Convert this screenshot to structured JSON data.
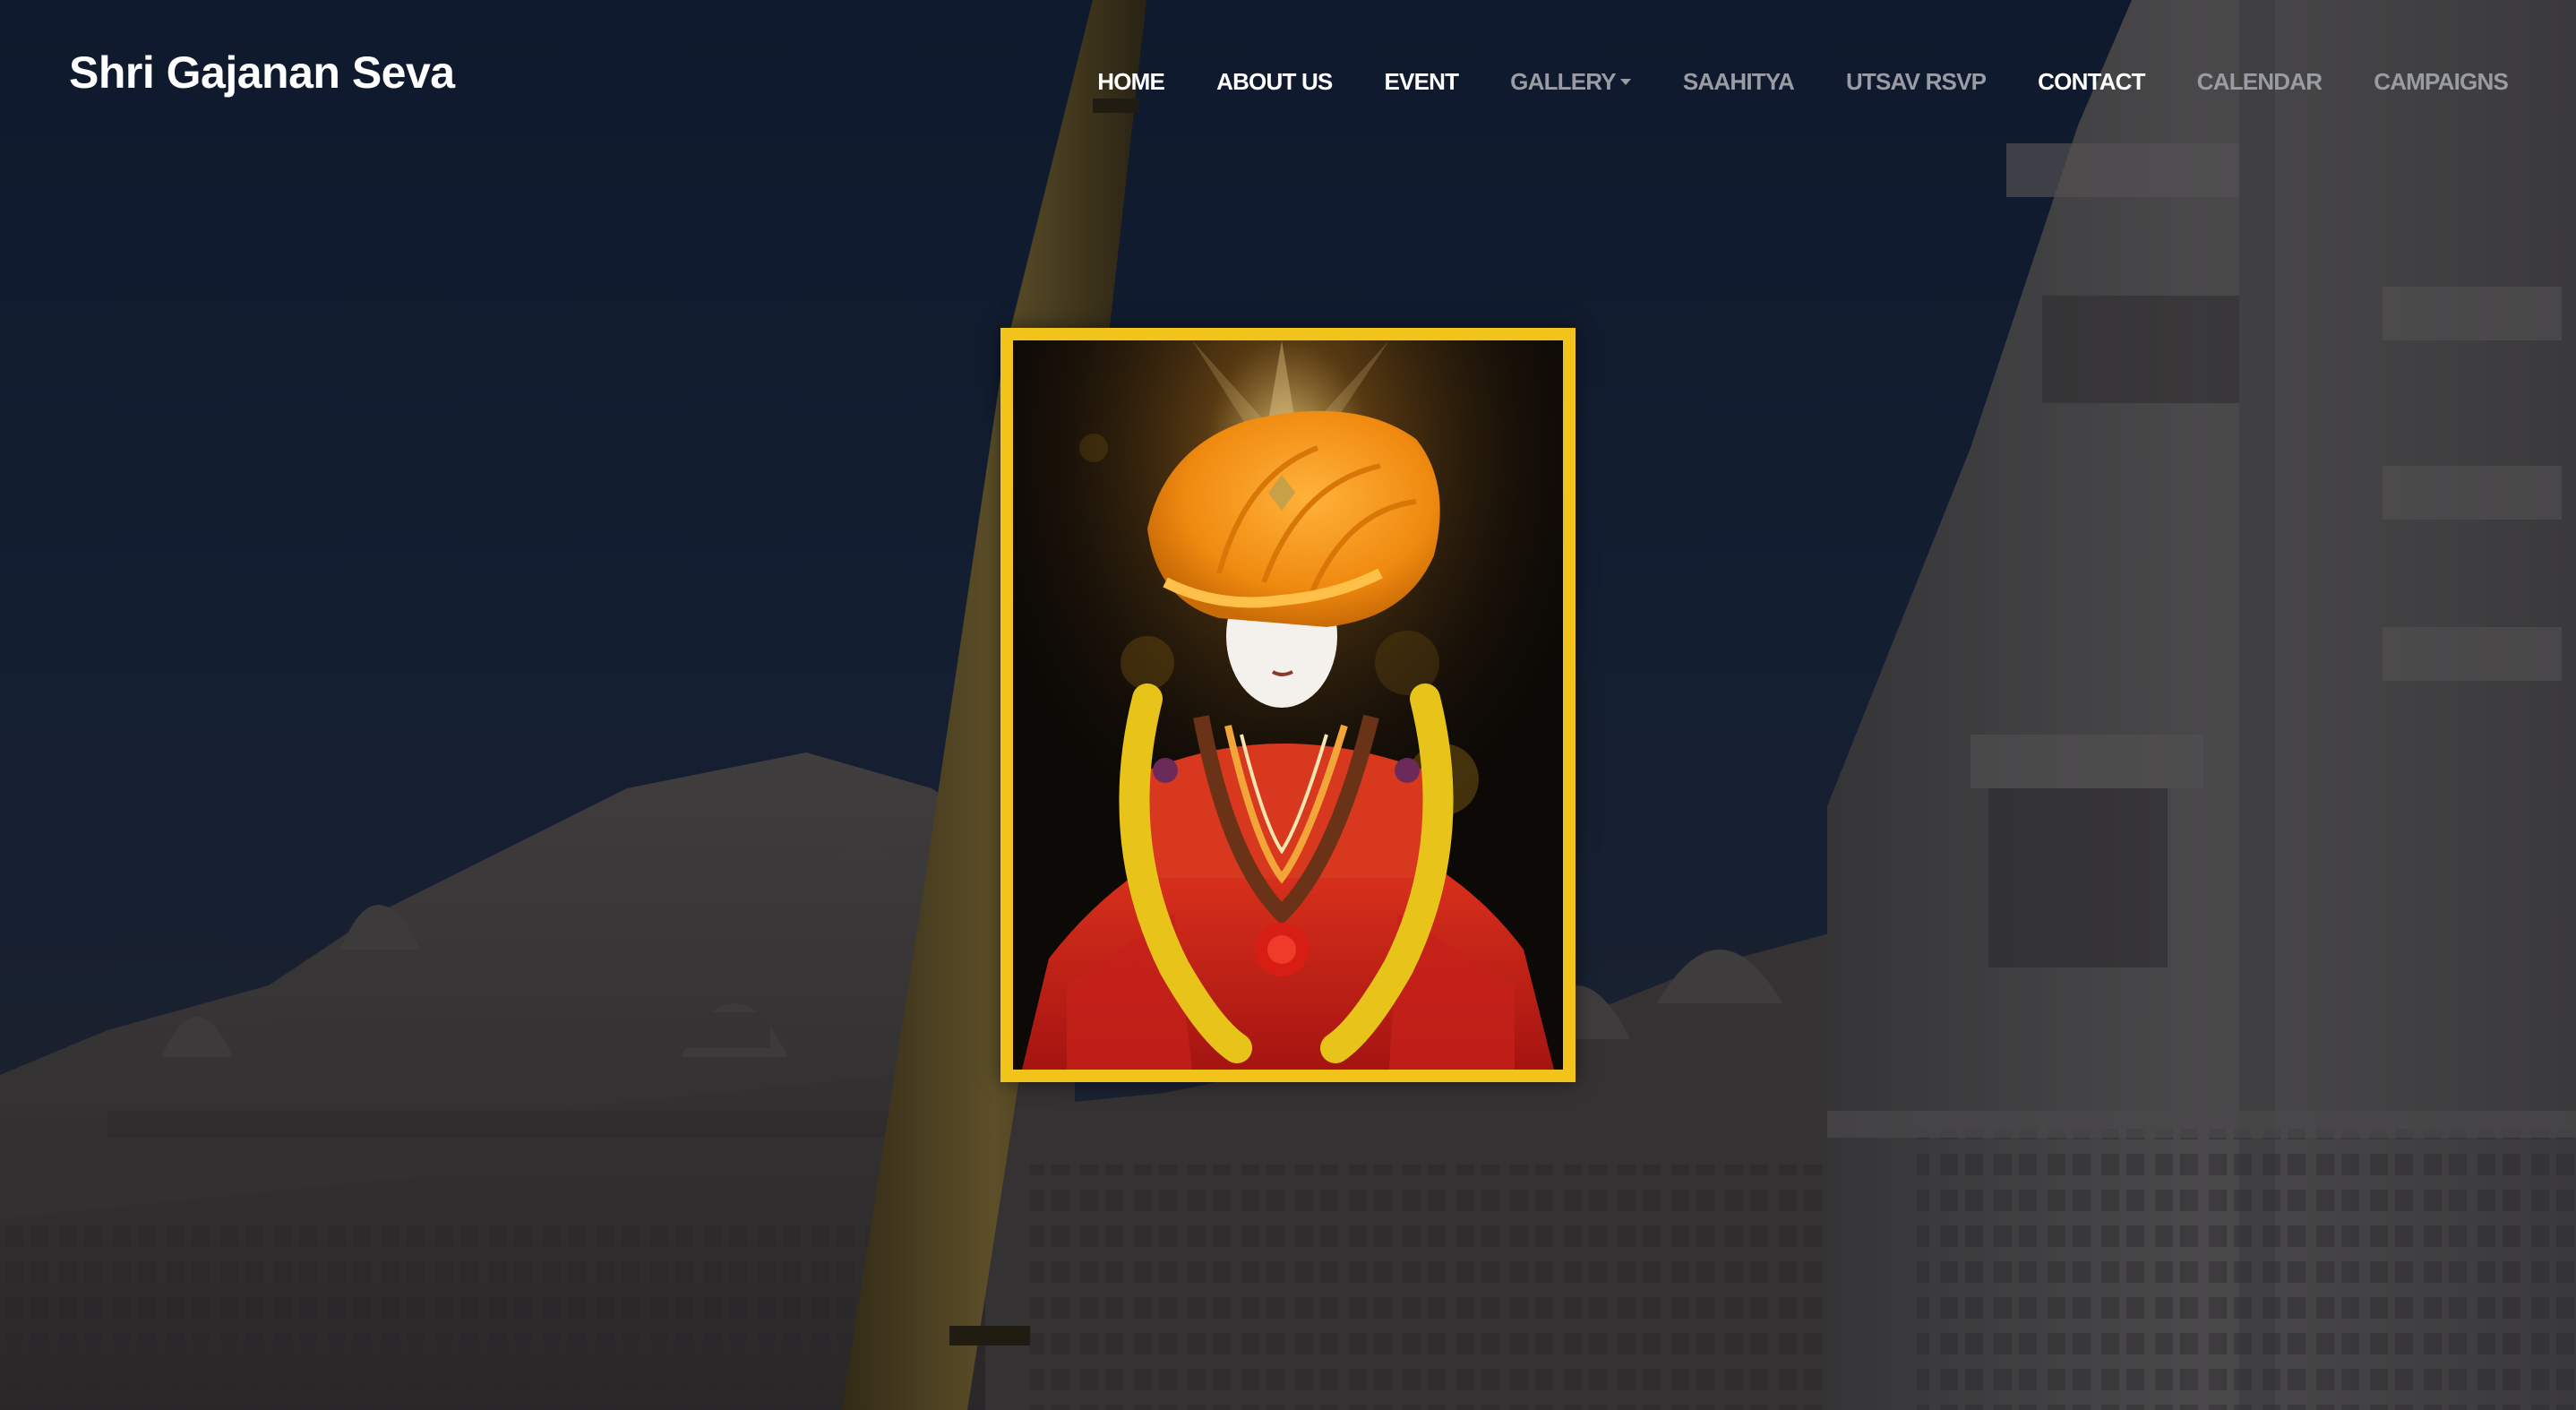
{
  "brand": {
    "title": "Shri Gajanan Seva"
  },
  "nav": {
    "items": [
      {
        "label": "HOME",
        "muted": false
      },
      {
        "label": "ABOUT US",
        "muted": false
      },
      {
        "label": "EVENT",
        "muted": false
      },
      {
        "label": "GALLERY",
        "muted": true,
        "dropdown": true
      },
      {
        "label": "SAAHITYA",
        "muted": true
      },
      {
        "label": "UTSAV RSVP",
        "muted": true
      },
      {
        "label": "CONTACT",
        "muted": false
      },
      {
        "label": "CALENDAR",
        "muted": true
      },
      {
        "label": "CAMPAIGNS",
        "muted": true
      }
    ]
  },
  "colors": {
    "frame": "#f2c31a",
    "nav_active": "#ffffff",
    "nav_muted": "#9a9ca3"
  },
  "hero": {
    "portrait_icon": "deity-portrait-image",
    "background_icon": "temple-background-image"
  }
}
